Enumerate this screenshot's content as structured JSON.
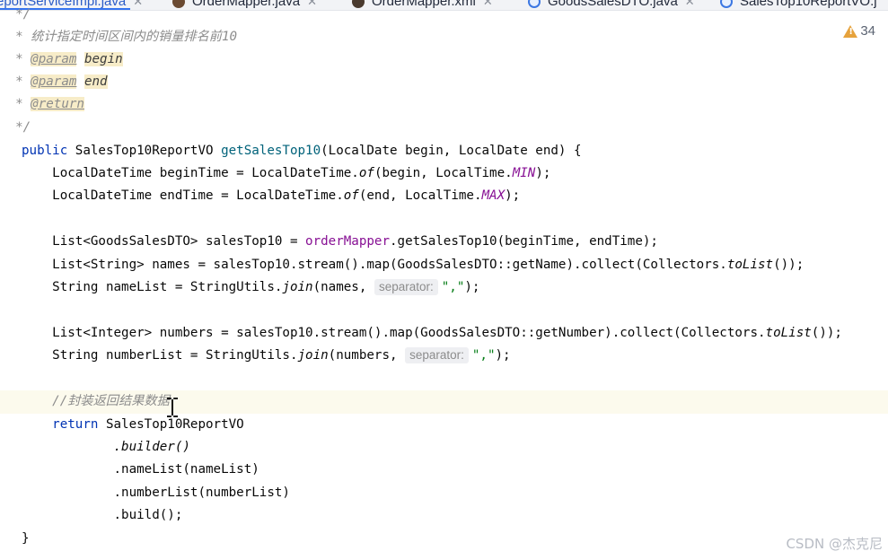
{
  "tabs": [
    {
      "label": "eportServiceImpl.java",
      "icon": "class-icon",
      "active": true
    },
    {
      "label": "OrderMapper.java",
      "icon": "java-icon"
    },
    {
      "label": "OrderMapper.xml",
      "icon": "xml-icon"
    },
    {
      "label": "GoodsSalesDTO.java",
      "icon": "class-icon"
    },
    {
      "label": "SalesTop10ReportVO.j",
      "icon": "class-icon"
    }
  ],
  "warnings": {
    "count": "34"
  },
  "code": {
    "l0": "  */",
    "l1": "  * 统计指定时间区间内的销量排名前10",
    "l2_star": "  * ",
    "l2_tag": "@param",
    "l2_name": "begin",
    "l3_star": "  * ",
    "l3_tag": "@param",
    "l3_name": "end",
    "l4_star": "  * ",
    "l4_tag": "@return",
    "l5": "  */",
    "l6_kw": "public",
    "l6_a": " SalesTop10ReportVO ",
    "l6_fn": "getSalesTop10",
    "l6_b": "(LocalDate begin, LocalDate end) {",
    "l7_a": "    LocalDateTime beginTime = LocalDateTime.",
    "l7_of": "of",
    "l7_b": "(begin, LocalTime.",
    "l7_c": "MIN",
    "l7_d": ");",
    "l8_a": "    LocalDateTime endTime = LocalDateTime.",
    "l8_of": "of",
    "l8_b": "(end, LocalTime.",
    "l8_c": "MAX",
    "l8_d": ");",
    "l10_a": "    List<GoodsSalesDTO> salesTop10 = ",
    "l10_fld": "orderMapper",
    "l10_b": ".getSalesTop10(beginTime, endTime);",
    "l11_a": "    List<String> names = salesTop10.stream().map(GoodsSalesDTO::getName).collect(Collectors.",
    "l11_it": "toList",
    "l11_b": "());",
    "l12_a": "    String nameList = StringUtils.",
    "l12_it": "join",
    "l12_b": "(names, ",
    "l12_hint": "separator:",
    "l12_str": "\",\"",
    "l12_c": ");",
    "l14_a": "    List<Integer> numbers = salesTop10.stream().map(GoodsSalesDTO::getNumber).collect(Collectors.",
    "l14_it": "toList",
    "l14_b": "());",
    "l15_a": "    String numberList = StringUtils.",
    "l15_it": "join",
    "l15_b": "(numbers, ",
    "l15_hint": "separator:",
    "l15_str": "\",\"",
    "l15_c": ");",
    "l17": "    //封装返回结果数据",
    "l18_kw": "    return",
    "l18_a": " SalesTop10ReportVO",
    "l19": "            .builder()",
    "l20": "            .nameList(nameList)",
    "l21": "            .numberList(numberList)",
    "l22": "            .build();",
    "l23": "}"
  },
  "watermark": "CSDN @杰克尼",
  "colors": {
    "keyword": "#0033b3",
    "method": "#00627a",
    "field": "#871094",
    "string": "#067d17",
    "comment": "#8c8c8c"
  }
}
